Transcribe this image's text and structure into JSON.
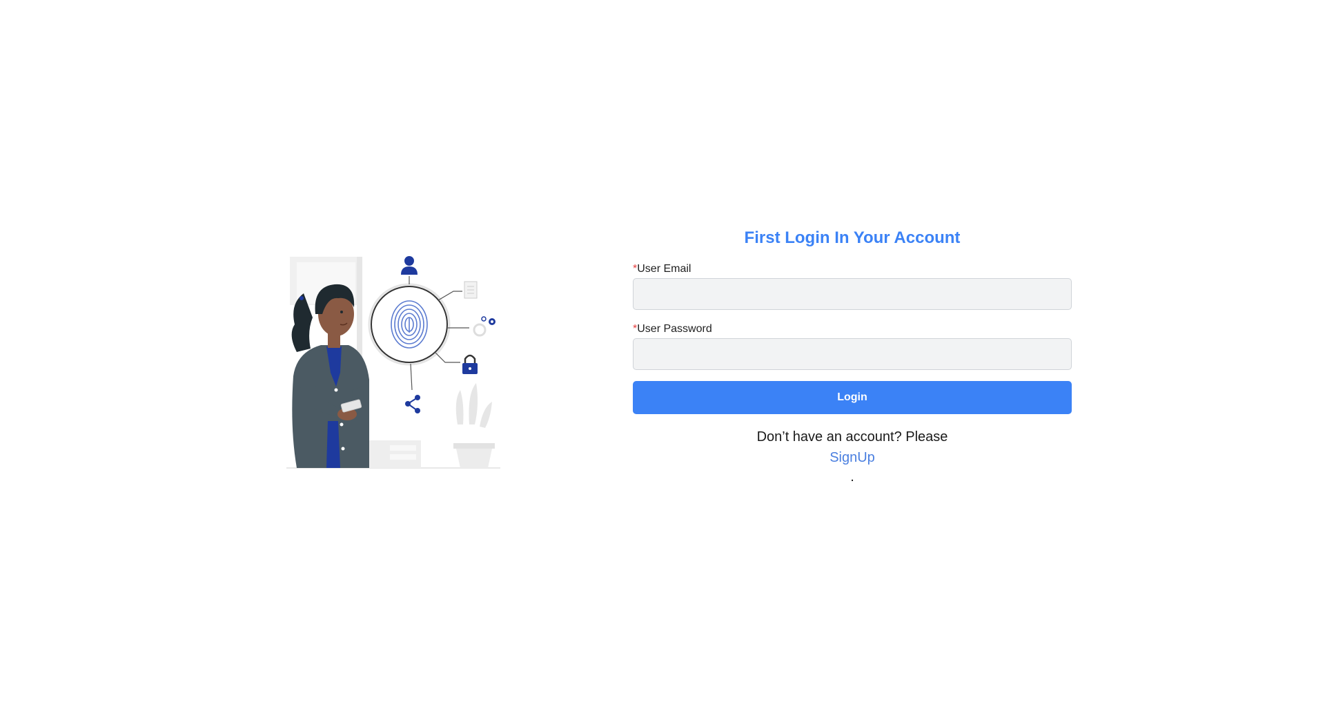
{
  "form": {
    "title": "First Login In Your Account",
    "email_label": "User Email",
    "email_required_mark": "*",
    "email_value": "",
    "password_label": "User Password",
    "password_required_mark": "*",
    "password_value": "",
    "login_label": "Login",
    "signup_prompt": "Don’t have an account? Please",
    "signup_link": "SignUp",
    "trailing_text": "."
  },
  "colors": {
    "accent": "#3b82f6",
    "link": "#4a7fe0",
    "required": "#e53e3e",
    "input_bg": "#f2f3f4",
    "illustration_blue": "#1e3a9e",
    "illustration_jacket": "#4b5a63",
    "illustration_skin": "#8a5a44"
  },
  "illustration": {
    "icons": [
      "user-icon",
      "fingerprint-icon",
      "document-icon",
      "gear-icon",
      "lock-icon",
      "share-icon"
    ]
  }
}
